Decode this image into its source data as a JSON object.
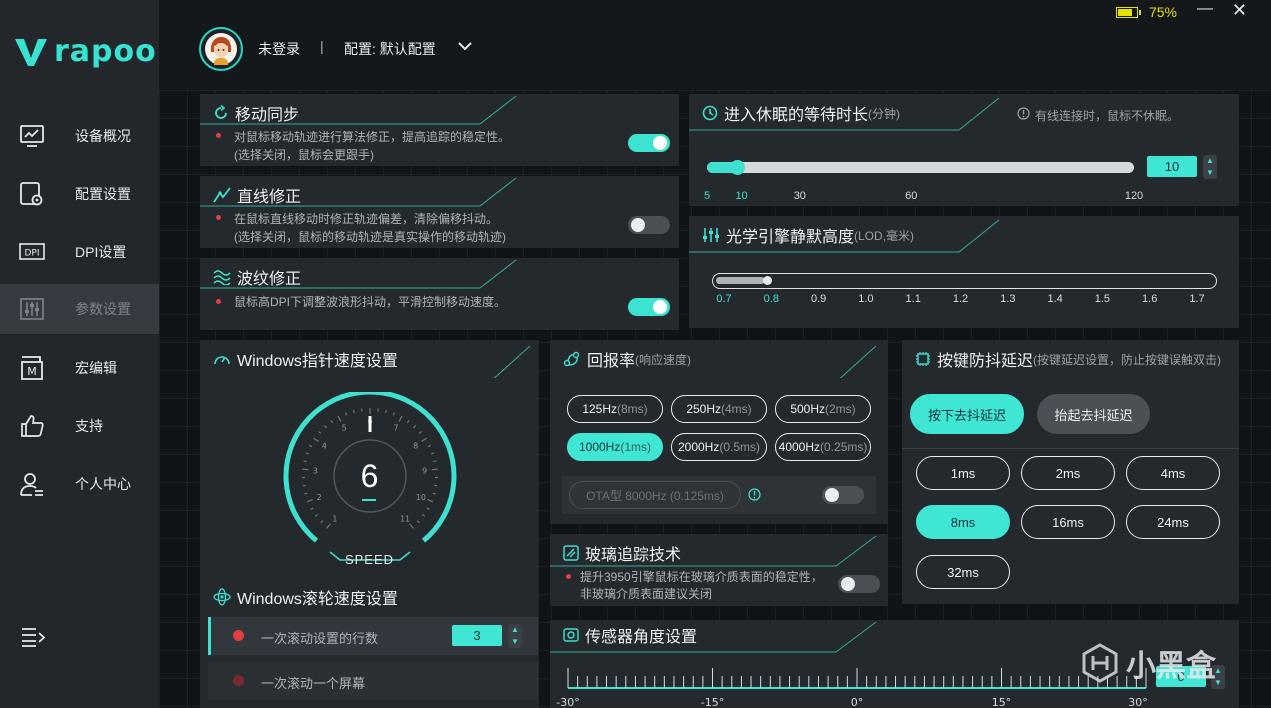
{
  "app": {
    "brand": "rapoo",
    "battery_text": "75%",
    "battery_level": 0.75,
    "minimize": "—",
    "close": "✕"
  },
  "header": {
    "user": "未登录",
    "separator": "|",
    "profile_label": "配置: 默认配置"
  },
  "sidebar": {
    "items": [
      {
        "label": "设备概况",
        "icon": "monitor-chart-icon"
      },
      {
        "label": "配置设置",
        "icon": "config-settings-icon"
      },
      {
        "label": "DPI设置",
        "icon": "dpi-icon"
      },
      {
        "label": "参数设置",
        "icon": "sliders-icon",
        "active": true
      },
      {
        "label": "宏编辑",
        "icon": "macro-icon"
      },
      {
        "label": "支持",
        "icon": "thumbs-up-icon"
      },
      {
        "label": "个人中心",
        "icon": "user-icon"
      }
    ],
    "menu_icon": "menu-icon"
  },
  "motion_sync": {
    "title": "移动同步",
    "desc1": "对鼠标移动轨迹进行算法修正，提高追踪的稳定性。",
    "desc2": "(选择关闭，鼠标会更跟手)",
    "enabled": true
  },
  "angle_snap": {
    "title": "直线修正",
    "desc1": "在鼠标直线移动时修正轨迹偏差，清除偏移抖动。",
    "desc2": "(选择关闭，鼠标的移动轨迹是真实操作的移动轨迹)",
    "enabled": false
  },
  "ripple": {
    "title": "波纹修正",
    "desc1": "鼠标高DPI下调整波浪形抖动，平滑控制移动速度。",
    "enabled": true
  },
  "sleep": {
    "title": "进入休眠的等待时长",
    "unit": "(分钟)",
    "note": "有线连接时，鼠标不休眠。",
    "value": "10",
    "min": 5,
    "max": 120,
    "current": 10,
    "ticks": [
      "5",
      "10",
      "30",
      "60",
      "120"
    ],
    "tick_values": [
      5,
      10,
      30,
      60,
      120
    ]
  },
  "lod": {
    "title": "光学引擎静默高度",
    "unit": "(LOD,毫米)",
    "ticks": [
      "0.7",
      "0.8",
      "0.9",
      "1.0",
      "1.1",
      "1.2",
      "1.3",
      "1.4",
      "1.5",
      "1.6",
      "1.7"
    ],
    "current": 0.8
  },
  "pointer_speed": {
    "title": "Windows指针速度设置",
    "value": "6",
    "caption": "SPEED",
    "dial_labels": [
      "1",
      "2",
      "3",
      "4",
      "5",
      "6",
      "7",
      "8",
      "9",
      "10",
      "11"
    ]
  },
  "scroll": {
    "title": "Windows滚轮速度设置",
    "option1": "一次滚动设置的行数",
    "option1_value": "3",
    "option2": "一次滚动一个屏幕"
  },
  "polling": {
    "title": "回报率",
    "subtitle": "(响应速度)",
    "rates": [
      {
        "main": "125Hz",
        "sub": "(8ms)"
      },
      {
        "main": "250Hz",
        "sub": "(4ms)"
      },
      {
        "main": "500Hz",
        "sub": "(2ms)"
      },
      {
        "main": "1000Hz",
        "sub": "(1ms)",
        "selected": true
      },
      {
        "main": "2000Hz",
        "sub": "(0.5ms)"
      },
      {
        "main": "4000Hz",
        "sub": "(0.25ms)"
      }
    ],
    "ota_label": "OTA型 8000Hz (0.125ms)",
    "ota_enabled": false
  },
  "glass": {
    "title": "玻璃追踪技术",
    "desc1": "提升3950引擎鼠标在玻璃介质表面的稳定性，",
    "desc2": "非玻璃介质表面建议关闭",
    "enabled": false
  },
  "debounce": {
    "title": "按键防抖延迟",
    "subtitle": "(按键延迟设置，防止按键误触双击)",
    "mode_press": "按下去抖延迟",
    "mode_release": "抬起去抖延迟",
    "values": [
      "1ms",
      "2ms",
      "4ms",
      "8ms",
      "16ms",
      "24ms",
      "32ms"
    ],
    "selected": "8ms"
  },
  "sensor_angle": {
    "title": "传感器角度设置",
    "ticks": [
      "-30°",
      "-15°",
      "0°",
      "15°",
      "30°"
    ],
    "value": "0"
  },
  "colors": {
    "accent": "#3ee0cf",
    "panel": "#24292d",
    "sidebar": "#23272b",
    "battery": "#e4e000",
    "alert_dot": "#e53e3e"
  },
  "watermark": "小黑盒"
}
